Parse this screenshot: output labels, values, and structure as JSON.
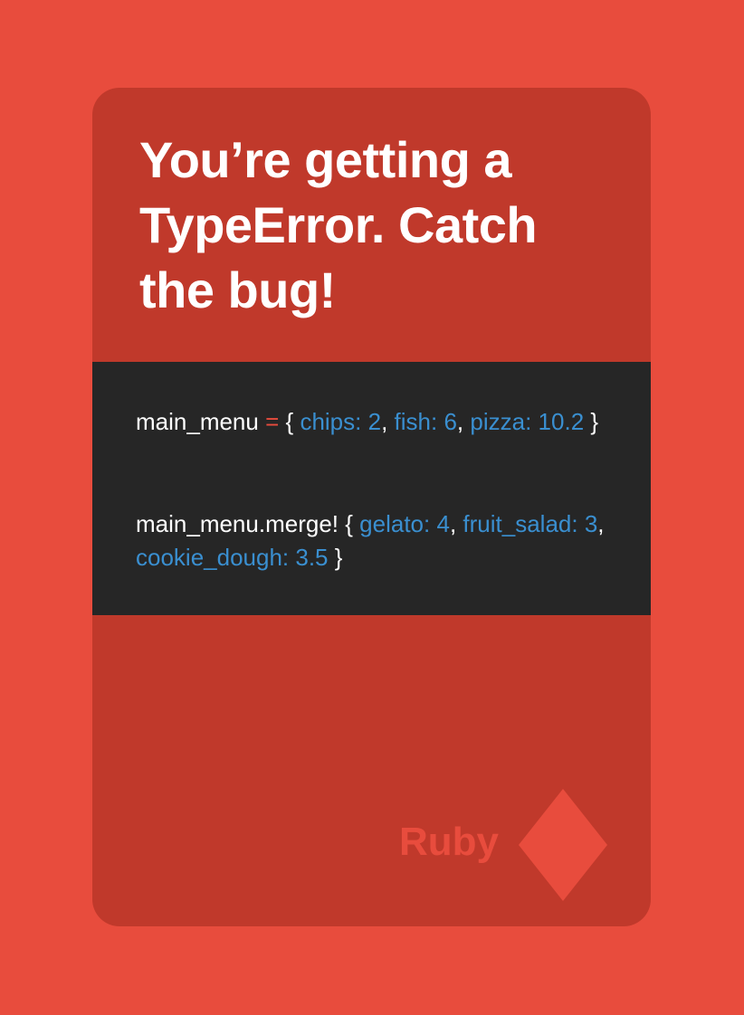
{
  "card": {
    "title": "You’re getting a TypeError. Catch the bug!",
    "suit_label": "Ruby",
    "suit_icon": "diamond-icon"
  },
  "code": {
    "line1": {
      "var": "main_menu",
      "op": "=",
      "open": "{",
      "k1": "chips:",
      "v1": "2",
      "sep1": ",",
      "k2": "fish:",
      "v2": "6",
      "sep2": ",",
      "k3": "pizza:",
      "v3": "10.2",
      "close": "}"
    },
    "line2": {
      "call": "main_menu.merge!",
      "open": "{",
      "k1": "gelato:",
      "v1": "4",
      "sep1": ",",
      "k2": "fruit_salad:",
      "v2": "3",
      "sep2": ",",
      "k3": "cookie_dough:",
      "v3": "3.5",
      "close": "}"
    }
  },
  "colors": {
    "background": "#e84c3d",
    "card": "#c0392b",
    "code_background": "#262626",
    "code_text": "#ffffff",
    "code_keyword": "#3a8fd0",
    "code_operator": "#e84c3d",
    "suit": "#e84c3d"
  }
}
